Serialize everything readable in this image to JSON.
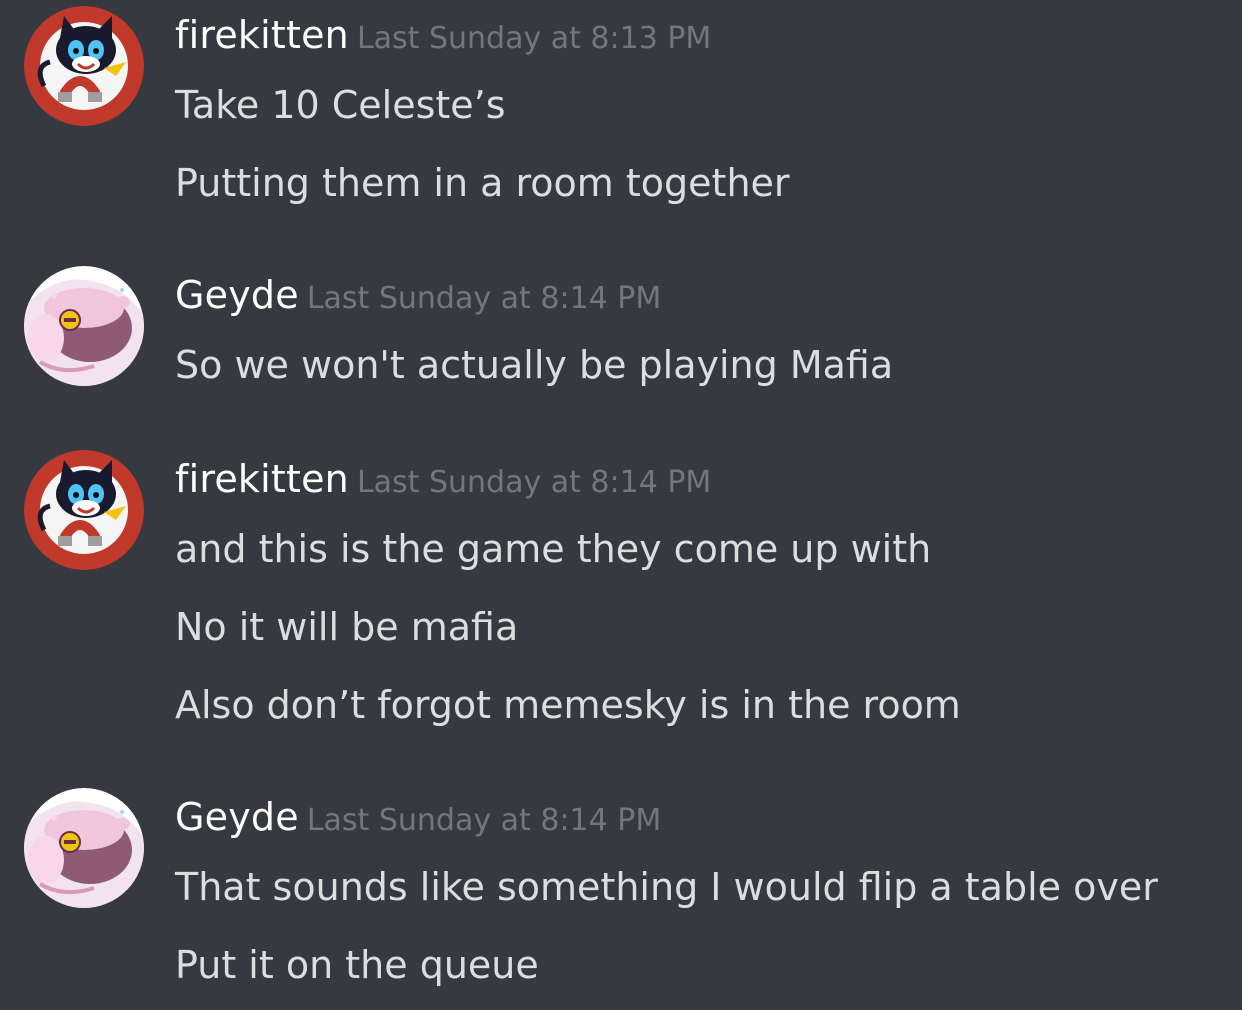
{
  "messages": [
    {
      "username": "firekitten",
      "timestamp": "Last Sunday at 8:13 PM",
      "avatar_icon": "black-cat-mascot-avatar",
      "lines": [
        "Take 10 Celeste’s",
        "Putting them in a room together"
      ]
    },
    {
      "username": "Geyde",
      "timestamp": "Last Sunday at 8:14 PM",
      "avatar_icon": "pink-creature-avatar",
      "lines": [
        "So we won't actually be playing Mafia"
      ]
    },
    {
      "username": "firekitten",
      "timestamp": "Last Sunday at 8:14 PM",
      "avatar_icon": "black-cat-mascot-avatar",
      "lines": [
        "and this is the game they come up with",
        "No it will be mafia",
        "Also don’t forgot memesky is in the room"
      ]
    },
    {
      "username": "Geyde",
      "timestamp": "Last Sunday at 8:14 PM",
      "avatar_icon": "pink-creature-avatar",
      "lines": [
        "That sounds like something I would flip a table over",
        "Put it on the queue"
      ]
    }
  ],
  "colors": {
    "background": "#36393f",
    "username": "#ffffff",
    "timestamp": "#72767d",
    "message_text": "#dcddde",
    "cat_avatar_bg": "#c0392b"
  }
}
